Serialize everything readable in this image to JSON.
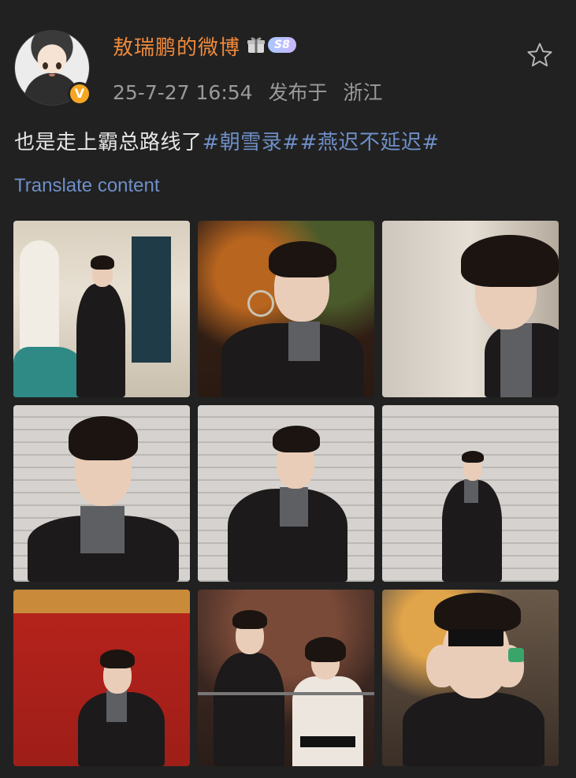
{
  "post": {
    "username": "敖瑞鹏的微博",
    "level": "S8",
    "timestamp": "25-7-27 16:54",
    "location_prefix": "发布于",
    "location": "浙江",
    "verified_mark": "V",
    "text": "也是走上霸总路线了",
    "hashtags": [
      "#朝雪录#",
      "#燕迟不延迟#"
    ],
    "translate_label": "Translate content"
  },
  "icons": {
    "star": "star-icon",
    "verified": "verified-icon",
    "gift": "gift-icon"
  },
  "colors": {
    "background": "#212121",
    "username": "#f08a3c",
    "link": "#6e8fc7",
    "verified": "#f5a623",
    "meta": "#9a9a9a"
  },
  "images": [
    {
      "scene": "p1"
    },
    {
      "scene": "p2"
    },
    {
      "scene": "p3"
    },
    {
      "scene": "p4"
    },
    {
      "scene": "p5"
    },
    {
      "scene": "p6"
    },
    {
      "scene": "p7"
    },
    {
      "scene": "p8"
    },
    {
      "scene": "p9"
    }
  ]
}
